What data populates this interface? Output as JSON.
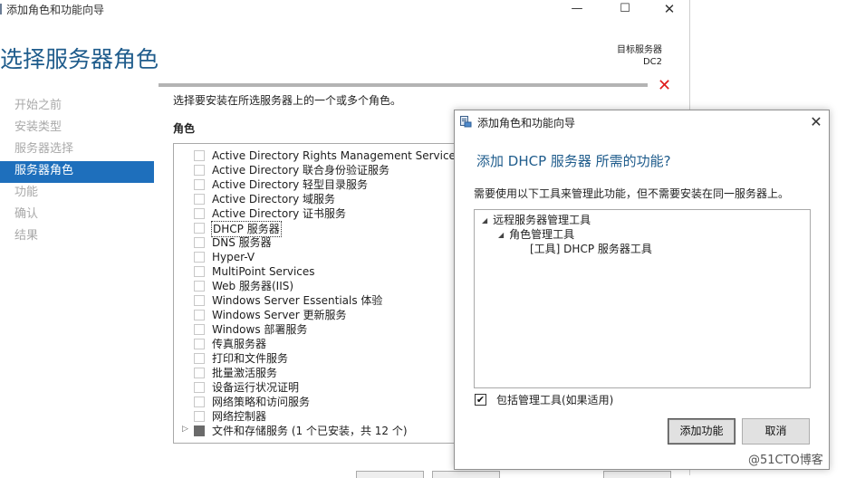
{
  "window": {
    "title": "添加角色和功能向导",
    "controls": {
      "minimize": "—",
      "maximize": "☐",
      "close": "✕"
    }
  },
  "header": {
    "page_title": "选择服务器角色",
    "dest_label": "目标服务器",
    "dest_server": "DC2",
    "error_mark": "✕",
    "error_color": "#e01b1b"
  },
  "nav": {
    "items": [
      {
        "label": "开始之前"
      },
      {
        "label": "安装类型"
      },
      {
        "label": "服务器选择"
      },
      {
        "label": "服务器角色"
      },
      {
        "label": "功能"
      },
      {
        "label": "确认"
      },
      {
        "label": "结果"
      }
    ],
    "active": "服务器角色",
    "active_color": "#1e6fbc"
  },
  "main": {
    "description": "选择要安装在所选服务器上的一个或多个角色。",
    "roles_header": "角色",
    "roles": [
      {
        "label": "Active Directory Rights Management Services"
      },
      {
        "label": "Active Directory 联合身份验证服务"
      },
      {
        "label": "Active Directory 轻型目录服务"
      },
      {
        "label": "Active Directory 域服务"
      },
      {
        "label": "Active Directory 证书服务"
      },
      {
        "label": "DHCP 服务器"
      },
      {
        "label": "DNS 服务器"
      },
      {
        "label": "Hyper-V"
      },
      {
        "label": "MultiPoint Services"
      },
      {
        "label": "Web 服务器(IIS)"
      },
      {
        "label": "Windows Server Essentials 体验"
      },
      {
        "label": "Windows Server 更新服务"
      },
      {
        "label": "Windows 部署服务"
      },
      {
        "label": "传真服务器"
      },
      {
        "label": "打印和文件服务"
      },
      {
        "label": "批量激活服务"
      },
      {
        "label": "设备运行状况证明"
      },
      {
        "label": "网络策略和访问服务"
      },
      {
        "label": "网络控制器"
      },
      {
        "label": "文件和存储服务 (1 个已安装，共 12 个)"
      }
    ],
    "selected_role": "DHCP 服务器"
  },
  "dialog": {
    "title": "添加角色和功能向导",
    "heading": "添加 DHCP 服务器 所需的功能?",
    "description": "需要使用以下工具来管理此功能，但不需要安装在同一服务器上。",
    "tree": {
      "level1": "远程服务器管理工具",
      "level2": "角色管理工具",
      "level3": "[工具] DHCP 服务器工具"
    },
    "include_tools_label": "包括管理工具(如果适用)",
    "include_tools_checked": true,
    "check_glyph": "✔",
    "add_button": "添加功能",
    "cancel_button": "取消",
    "close_glyph": "✕"
  },
  "watermark": "@51CTO博客"
}
